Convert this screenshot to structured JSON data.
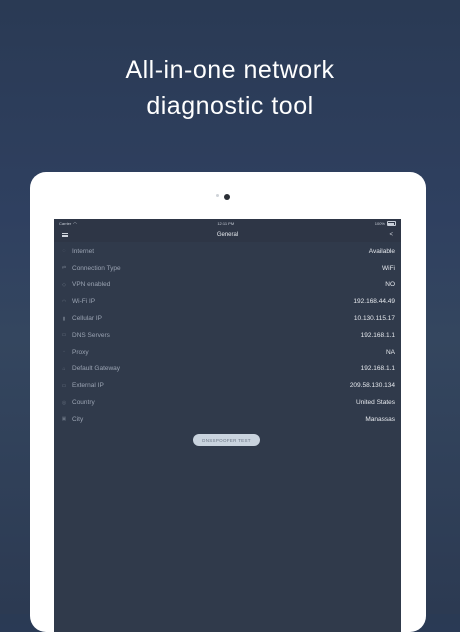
{
  "headline": {
    "line1": "All-in-one network",
    "line2": "diagnostic tool"
  },
  "statusbar": {
    "carrier": "Carrier",
    "time": "12:11 PM",
    "battery": "100%"
  },
  "navbar": {
    "title": "General",
    "menu_icon": "hamburger-menu-icon",
    "share_icon": "share-icon"
  },
  "rows": [
    {
      "label": "Internet",
      "value": "Available",
      "icon": "globe-icon"
    },
    {
      "label": "Connection Type",
      "value": "WiFi",
      "icon": "connection-icon"
    },
    {
      "label": "VPN enabled",
      "value": "NO",
      "icon": "vpn-icon"
    },
    {
      "label": "Wi-Fi IP",
      "value": "192.168.44.49",
      "icon": "wifi-icon"
    },
    {
      "label": "Cellular IP",
      "value": "10.130.115.17",
      "icon": "cellular-icon"
    },
    {
      "label": "DNS Servers",
      "value": "192.168.1.1",
      "icon": "dns-icon"
    },
    {
      "label": "Proxy",
      "value": "NA",
      "icon": "proxy-icon"
    },
    {
      "label": "Default Gateway",
      "value": "192.168.1.1",
      "icon": "gateway-icon"
    },
    {
      "label": "External IP",
      "value": "209.58.130.134",
      "icon": "external-ip-icon"
    },
    {
      "label": "Country",
      "value": "United States",
      "icon": "country-icon"
    },
    {
      "label": "City",
      "value": "Manassas",
      "icon": "city-icon"
    }
  ],
  "test_button": {
    "label": "DNSSPOOFER TEST"
  }
}
